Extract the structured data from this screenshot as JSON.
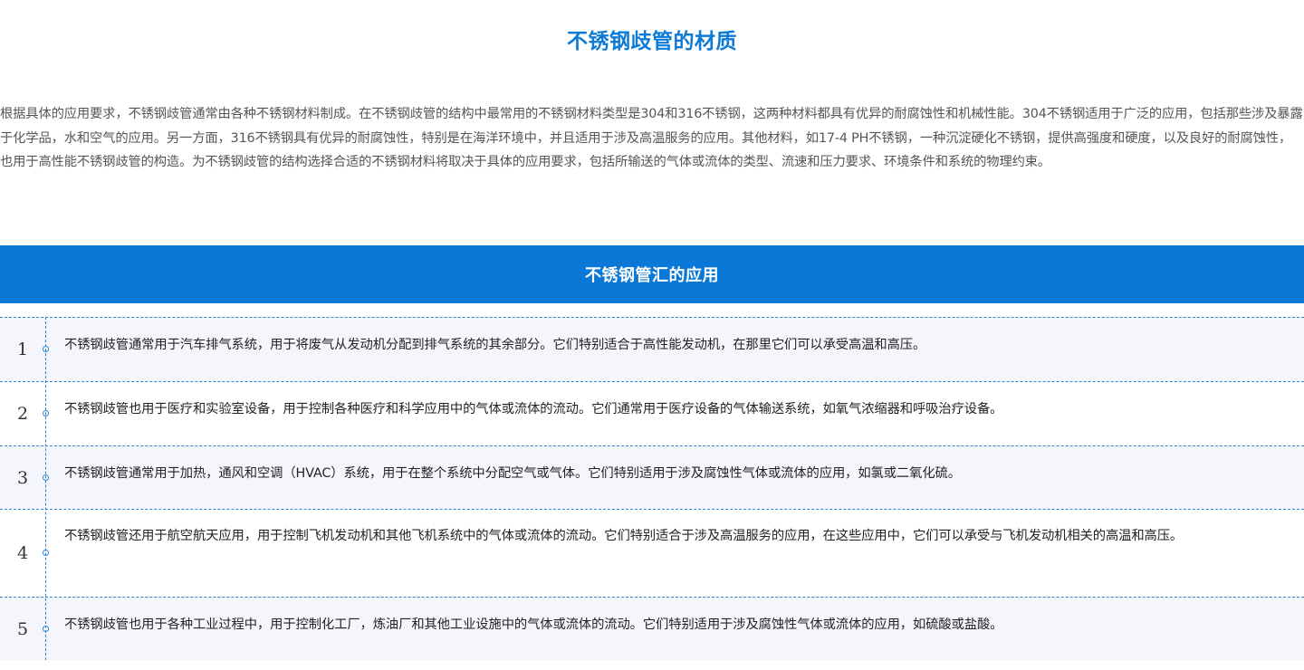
{
  "materials": {
    "title": "不锈钢歧管的材质",
    "intro": "根据具体的应用要求，不锈钢歧管通常由各种不锈钢材料制成。在不锈钢歧管的结构中最常用的不锈钢材料类型是304和316不锈钢，这两种材料都具有优异的耐腐蚀性和机械性能。304不锈钢适用于广泛的应用，包括那些涉及暴露于化学品，水和空气的应用。另一方面，316不锈钢具有优异的耐腐蚀性，特别是在海洋环境中，并且适用于涉及高温服务的应用。其他材料，如17-4 PH不锈钢，一种沉淀硬化不锈钢，提供高强度和硬度，以及良好的耐腐蚀性，也用于高性能不锈钢歧管的构造。为不锈钢歧管的结构选择合适的不锈钢材料将取决于具体的应用要求，包括所输送的气体或流体的类型、流速和压力要求、环境条件和系统的物理约束。"
  },
  "applications": {
    "title": "不锈钢管汇的应用",
    "items": [
      {
        "number": "1",
        "text": "不锈钢歧管通常用于汽车排气系统，用于将废气从发动机分配到排气系统的其余部分。它们特别适合于高性能发动机，在那里它们可以承受高温和高压。"
      },
      {
        "number": "2",
        "text": "不锈钢歧管也用于医疗和实验室设备，用于控制各种医疗和科学应用中的气体或流体的流动。它们通常用于医疗设备的气体输送系统，如氧气浓缩器和呼吸治疗设备。"
      },
      {
        "number": "3",
        "text": "不锈钢歧管通常用于加热，通风和空调（HVAC）系统，用于在整个系统中分配空气或气体。它们特别适用于涉及腐蚀性气体或流体的应用，如氯或二氧化硫。"
      },
      {
        "number": "4",
        "text": "不锈钢歧管还用于航空航天应用，用于控制飞机发动机和其他飞机系统中的气体或流体的流动。它们特别适合于涉及高温服务的应用，在这些应用中，它们可以承受与飞机发动机相关的高温和高压。"
      },
      {
        "number": "5",
        "text": "不锈钢歧管也用于各种工业过程中，用于控制化工厂，炼油厂和其他工业设施中的气体或流体的流动。它们特别适用于涉及腐蚀性气体或流体的应用，如硫酸或盐酸。"
      }
    ]
  },
  "colors": {
    "accent": "#0a78d6",
    "title_blue": "#0d7bd6",
    "row_shade": "#f4f6fb",
    "divider": "#2b86d8"
  }
}
